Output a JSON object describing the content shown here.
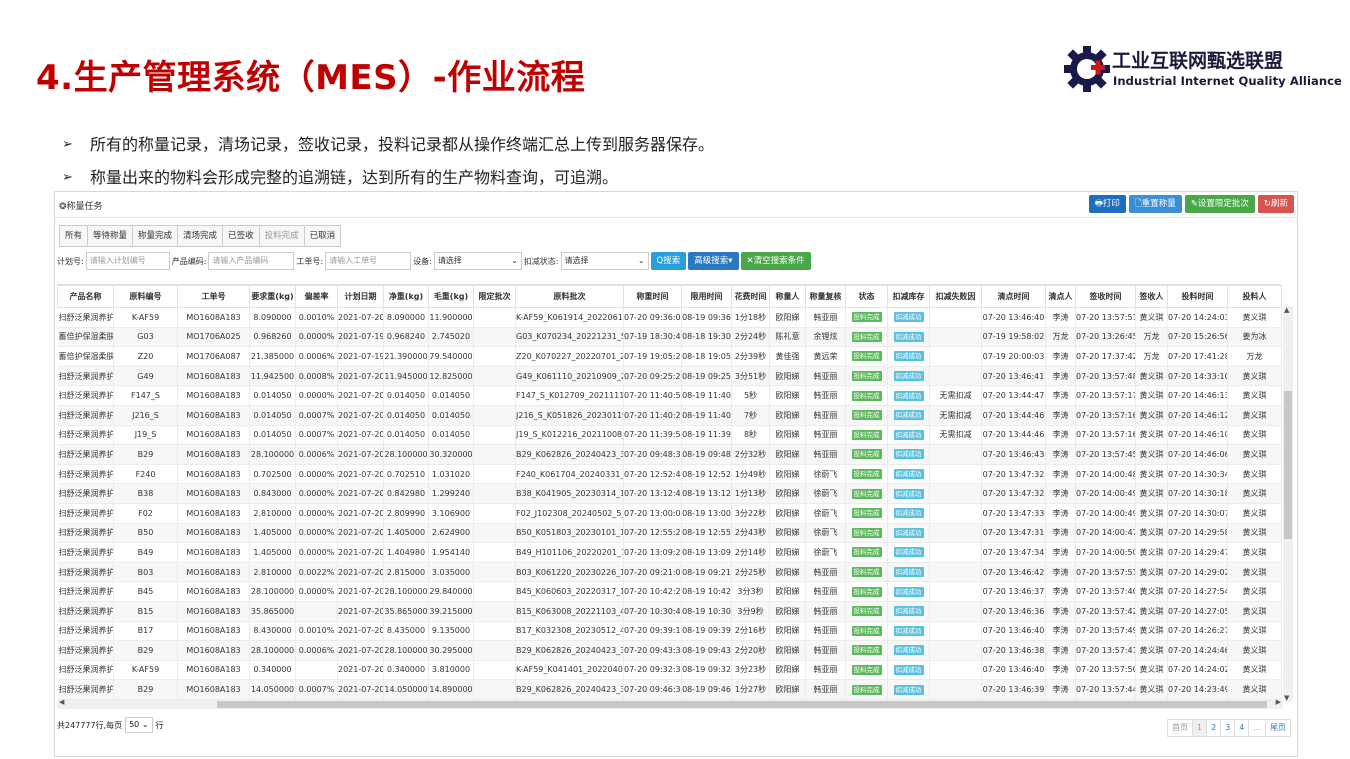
{
  "slide": {
    "title": "4.生产管理系统（MES）-作业流程",
    "logo_cn": "工业互联网甄选联盟",
    "logo_en": "Industrial Internet Quality Alliance",
    "bullets": [
      "所有的称量记录，清场记录，签收记录，投料记录都从操作终端汇总上传到服务器保存。",
      "称量出来的物料会形成完整的追溯链，达到所有的生产物料查询，可追溯。"
    ]
  },
  "panel": {
    "title": "❂称量任务",
    "buttons": [
      "🖶打印",
      "🗋重置称量",
      "✎设置限定批次",
      "↻刷新"
    ],
    "tabs": [
      "所有",
      "等待称量",
      "称量完成",
      "清场完成",
      "已签收",
      "投料完成",
      "已取消"
    ],
    "search": {
      "plan_label": "计划号:",
      "plan_placeholder": "请输入计划编号",
      "product_label": "产品编码:",
      "product_placeholder": "请输入产品编码",
      "order_label": "工单号:",
      "order_placeholder": "请输入工单号",
      "device_label": "设备:",
      "device_value": "请选择",
      "deduct_label": "扣减状态:",
      "deduct_value": "请选择",
      "search_btn": "Q搜索",
      "advanced_btn": "高级搜索▾",
      "clear_btn": "✕清空搜索条件"
    },
    "columns": [
      "产品名称",
      "原料编号",
      "工单号",
      "要求重(kg)",
      "偏差率",
      "计划日期",
      "净重(kg)",
      "毛重(kg)",
      "限定批次",
      "原料批次",
      "称重时间",
      "限用时间",
      "花费时间",
      "称量人",
      "称量复核",
      "状态",
      "扣减库存",
      "扣减失败因",
      "清点时间",
      "清点人",
      "签收时间",
      "签收人",
      "投料时间",
      "投料人"
    ],
    "status_tag": "投料完成",
    "stock_tag": "扣减成功",
    "rows": [
      [
        "扫舒泛果润养护…",
        "K-AF59",
        "MO1608A183",
        "8.090000",
        "0.0010%",
        "2021-07-20",
        "8.090000",
        "11.900000",
        "",
        "K-AF59_K061914_20220614_…",
        "07-20 09:36:08",
        "08-19 09:36",
        "1分18秒",
        "欧阳娣",
        "韩亚丽",
        "",
        "07-20 13:46:40",
        "李涛",
        "07-20 13:57:51",
        "黄义琪",
        "07-20 14:24:03",
        "黄义琪"
      ],
      [
        "蓄倍护保湿柔肤水",
        "G03",
        "MO1706A025",
        "0.968260",
        "0.0000%",
        "2021-07-19",
        "0.968240",
        "2.745020",
        "",
        "G03_K070234_20221231_5_…",
        "07-19 18:30:46",
        "08-18 19:30",
        "2分24秒",
        "陈礼意",
        "余锂炫",
        "",
        "07-19 19:58:02",
        "万龙",
        "07-20 13:26:45",
        "万龙",
        "07-20 15:26:56",
        "姜为冰"
      ],
      [
        "蓄倍护保湿柔肤水",
        "Z20",
        "MO1706A087",
        "21.385000",
        "0.0006%",
        "2021-07-19",
        "21.390000",
        "79.540000",
        "",
        "Z20_K070227_20220701_2_2",
        "07-19 19:05:26",
        "08-18 19:05",
        "2分39秒",
        "黄佳强",
        "黄远荣",
        "",
        "07-19 20:00:03",
        "李涛",
        "07-20 17:37:42",
        "万龙",
        "07-20 17:41:28",
        "万龙"
      ],
      [
        "扫舒泛果润养护…",
        "G49",
        "MO1608A183",
        "11.942500",
        "0.0008%",
        "2021-07-20",
        "11.945000",
        "12.825000",
        "",
        "G49_K061110_20210909_2_1",
        "07-20 09:25:21",
        "08-19 09:25",
        "3分51秒",
        "欧阳娣",
        "韩亚丽",
        "",
        "07-20 13:46:41",
        "李涛",
        "07-20 13:57:48",
        "黄义琪",
        "07-20 14:33:10",
        "黄义琪"
      ],
      [
        "扫舒泛果润养护…",
        "F147_S",
        "MO1608A183",
        "0.014050",
        "0.0000%",
        "2021-07-20",
        "0.014050",
        "0.014050",
        "",
        "F147_S_K012709_20211111_…",
        "07-20 11:40:54",
        "08-19 11:40",
        "5秒",
        "欧阳娣",
        "韩亚丽",
        "无需扣减",
        "07-20 13:44:47",
        "李涛",
        "07-20 13:57:17",
        "黄义琪",
        "07-20 14:46:13",
        "黄义琪"
      ],
      [
        "扫舒泛果润养护…",
        "J216_S",
        "MO1608A183",
        "0.014050",
        "0.0007%",
        "2021-07-20",
        "0.014050",
        "0.014050",
        "",
        "J216_S_K051826_20230119_…",
        "07-20 11:40:24",
        "08-19 11:40",
        "7秒",
        "欧阳娣",
        "韩亚丽",
        "无需扣减",
        "07-20 13:44:46",
        "李涛",
        "07-20 13:57:16",
        "黄义琪",
        "07-20 14:46:12",
        "黄义琪"
      ],
      [
        "扫舒泛果润养护…",
        "J19_S",
        "MO1608A183",
        "0.014050",
        "0.0007%",
        "2021-07-20",
        "0.014050",
        "0.014050",
        "",
        "J19_S_K012216_20211008_1_1",
        "07-20 11:39:55",
        "08-19 11:39",
        "8秒",
        "欧阳娣",
        "韩亚丽",
        "无需扣减",
        "07-20 13:44:46",
        "李涛",
        "07-20 13:57:16",
        "黄义琪",
        "07-20 14:46:10",
        "黄义琪"
      ],
      [
        "扫舒泛果润养护…",
        "B29",
        "MO1608A183",
        "28.100000",
        "0.0006%",
        "2021-07-20",
        "28.100000",
        "30.320000",
        "",
        "B29_K062826_20240423_3_3",
        "07-20 09:48:32",
        "08-19 09:48",
        "2分32秒",
        "欧阳娣",
        "韩亚丽",
        "",
        "07-20 13:46:43",
        "李涛",
        "07-20 13:57:45",
        "黄义琪",
        "07-20 14:46:06",
        "黄义琪"
      ],
      [
        "扫舒泛果润养护…",
        "F240",
        "MO1608A183",
        "0.702500",
        "0.0000%",
        "2021-07-20",
        "0.702510",
        "1.031020",
        "",
        "F240_K061704_20240331_2_1",
        "07-20 12:52:40",
        "08-19 12:52",
        "1分49秒",
        "欧阳娣",
        "徐蔚飞",
        "",
        "07-20 13:47:32",
        "李涛",
        "07-20 14:00:48",
        "黄义琪",
        "07-20 14:30:34",
        "黄义琪"
      ],
      [
        "扫舒泛果润养护…",
        "B38",
        "MO1608A183",
        "0.843000",
        "0.0000%",
        "2021-07-20",
        "0.842980",
        "1.299240",
        "",
        "B38_K041905_20230314_1_1",
        "07-20 13:12:40",
        "08-19 13:12",
        "1分13秒",
        "欧阳娣",
        "徐蔚飞",
        "",
        "07-20 13:47:32",
        "李涛",
        "07-20 14:00:49",
        "黄义琪",
        "07-20 14:30:18",
        "黄义琪"
      ],
      [
        "扫舒泛果润养护…",
        "F02",
        "MO1608A183",
        "2.810000",
        "0.0000%",
        "2021-07-20",
        "2.809990",
        "3.106900",
        "",
        "F02_J102308_20240502_5_2",
        "07-20 13:00:03",
        "08-19 13:00",
        "3分22秒",
        "欧阳娣",
        "徐蔚飞",
        "",
        "07-20 13:47:33",
        "李涛",
        "07-20 14:00:49",
        "黄义琪",
        "07-20 14:30:07",
        "黄义琪"
      ],
      [
        "扫舒泛果润养护…",
        "B50",
        "MO1608A183",
        "1.405000",
        "0.0000%",
        "2021-07-20",
        "1.405000",
        "2.624900",
        "",
        "B50_K051803_20230101_1_1",
        "07-20 12:55:27",
        "08-19 12:55",
        "2分43秒",
        "欧阳娣",
        "徐蔚飞",
        "",
        "07-20 13:47:31",
        "李涛",
        "07-20 14:00:47",
        "黄义琪",
        "07-20 14:29:58",
        "黄义琪"
      ],
      [
        "扫舒泛果润养护…",
        "B49",
        "MO1608A183",
        "1.405000",
        "0.0000%",
        "2021-07-20",
        "1.404980",
        "1.954140",
        "",
        "B49_H101106_20220201_12_3",
        "07-20 13:09:20",
        "08-19 13:09",
        "2分14秒",
        "欧阳娣",
        "徐蔚飞",
        "",
        "07-20 13:47:34",
        "李涛",
        "07-20 14:00:50",
        "黄义琪",
        "07-20 14:29:47",
        "黄义琪"
      ],
      [
        "扫舒泛果润养护…",
        "B03",
        "MO1608A183",
        "2.810000",
        "0.0022%",
        "2021-07-20",
        "2.815000",
        "3.035000",
        "",
        "B03_K061220_20230226_1_1",
        "07-20 09:21:02",
        "08-19 09:21",
        "2分25秒",
        "欧阳娣",
        "韩亚丽",
        "",
        "07-20 13:46:42",
        "李涛",
        "07-20 13:57:51",
        "黄义琪",
        "07-20 14:29:02",
        "黄义琪"
      ],
      [
        "扫舒泛果润养护…",
        "B45",
        "MO1608A183",
        "28.100000",
        "0.0000%",
        "2021-07-20",
        "28.100000",
        "29.840000",
        "",
        "B45_K060603_20220317_1_1",
        "07-20 10:42:20",
        "08-19 10:42",
        "3分3秒",
        "欧阳娣",
        "韩亚丽",
        "",
        "07-20 13:46:37",
        "李涛",
        "07-20 13:57:40",
        "黄义琪",
        "07-20 14:27:54",
        "黄义琪"
      ],
      [
        "扫舒泛果润养护…",
        "B15",
        "MO1608A183",
        "35.865000",
        "",
        "2021-07-20",
        "35.865000",
        "39.215000",
        "",
        "B15_K063008_20221103_4_4",
        "07-20 10:30:41",
        "08-19 10:30",
        "3分9秒",
        "欧阳娣",
        "韩亚丽",
        "",
        "07-20 13:46:36",
        "李涛",
        "07-20 13:57:42",
        "黄义琪",
        "07-20 14:27:05",
        "黄义琪"
      ],
      [
        "扫舒泛果润养护…",
        "B17",
        "MO1608A183",
        "8.430000",
        "0.0010%",
        "2021-07-20",
        "8.435000",
        "9.135000",
        "",
        "B17_K032308_20230512_4_3",
        "07-20 09:39:18",
        "08-19 09:39",
        "2分16秒",
        "欧阳娣",
        "韩亚丽",
        "",
        "07-20 13:46:40",
        "李涛",
        "07-20 13:57:49",
        "黄义琪",
        "07-20 14:26:27",
        "黄义琪"
      ],
      [
        "扫舒泛果润养护…",
        "B29",
        "MO1608A183",
        "28.100000",
        "0.0006%",
        "2021-07-20",
        "28.100000",
        "30.295000",
        "",
        "B29_K062826_20240423_3_3",
        "07-20 09:43:36",
        "08-19 09:43",
        "2分20秒",
        "欧阳娣",
        "韩亚丽",
        "",
        "07-20 13:46:38",
        "李涛",
        "07-20 13:57:41",
        "黄义琪",
        "07-20 14:24:46",
        "黄义琪"
      ],
      [
        "扫舒泛果润养护…",
        "K-AF59",
        "MO1608A183",
        "0.340000",
        "",
        "2021-07-20",
        "0.340000",
        "3.810000",
        "",
        "K-AF59_K041401_20220406_…",
        "07-20 09:32:31",
        "08-19 09:32",
        "3分23秒",
        "欧阳娣",
        "韩亚丽",
        "",
        "07-20 13:46:40",
        "李涛",
        "07-20 13:57:50",
        "黄义琪",
        "07-20 14:24:02",
        "黄义琪"
      ],
      [
        "扫舒泛果润养护…",
        "B29",
        "MO1608A183",
        "14.050000",
        "0.0007%",
        "2021-07-20",
        "14.050000",
        "14.890000",
        "",
        "B29_K062826_20240423_3_3",
        "07-20 09:46:31",
        "08-19 09:46",
        "1分27秒",
        "欧阳娣",
        "韩亚丽",
        "",
        "07-20 13:46:39",
        "李涛",
        "07-20 13:57:44",
        "黄义琪",
        "07-20 14:23:49",
        "黄义琪"
      ]
    ],
    "footer": {
      "total_text": "共247777行,每页",
      "page_size": "50",
      "rows_suffix": "行",
      "pager": [
        "首页",
        "1",
        "2",
        "3",
        "4",
        "...",
        "尾页"
      ]
    }
  }
}
